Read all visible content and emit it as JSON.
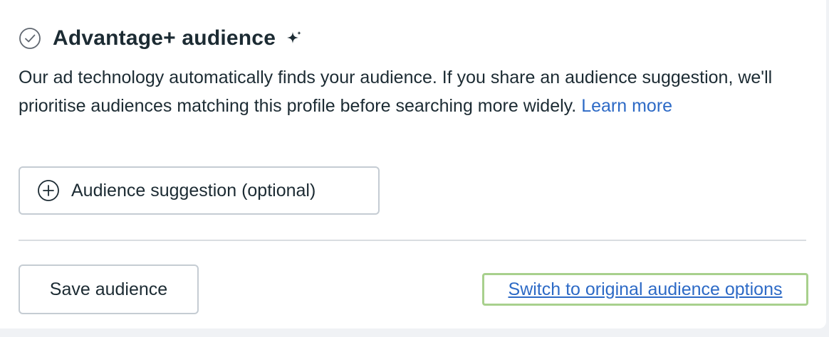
{
  "section": {
    "title": "Advantage+ audience",
    "title_icon": "check-circle-icon",
    "title_badge_icon": "sparkle-icon",
    "description": "Our ad technology automatically finds your audience. If you share an audience suggestion, we'll prioritise audiences matching this profile before searching more widely.",
    "learn_more_label": "Learn more"
  },
  "suggestion_button": {
    "icon": "plus-circle-icon",
    "label": "Audience suggestion (optional)"
  },
  "footer": {
    "save_label": "Save audience",
    "switch_label": "Switch to original audience options"
  },
  "colors": {
    "text": "#1c2b33",
    "link": "#2d6ac6",
    "border": "#c5ccd3",
    "focus_ring": "#a8d08d"
  }
}
